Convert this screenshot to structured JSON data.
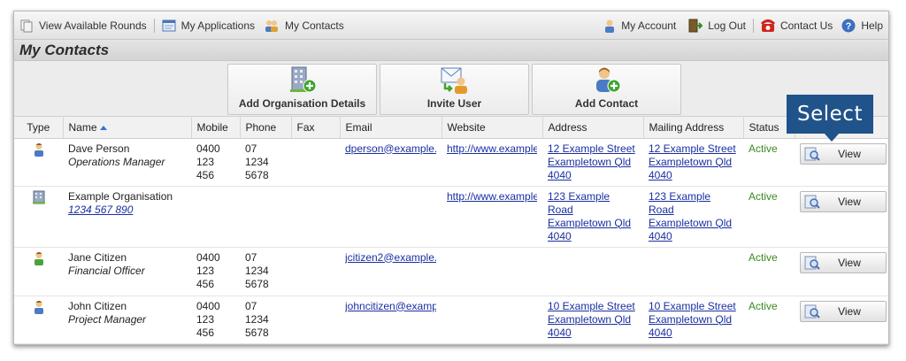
{
  "nav": {
    "left": [
      {
        "label": "View Available Rounds",
        "icon": "rounds-icon"
      },
      {
        "label": "My Applications",
        "icon": "applications-icon"
      },
      {
        "label": "My Contacts",
        "icon": "contacts-icon"
      }
    ],
    "right": [
      {
        "label": "My Account",
        "icon": "account-icon"
      },
      {
        "label": "Log Out",
        "icon": "logout-icon"
      },
      {
        "label": "Contact Us",
        "icon": "phone-icon"
      },
      {
        "label": "Help",
        "icon": "help-icon"
      }
    ]
  },
  "page_title": "My Contacts",
  "actions": [
    {
      "label": "Add Organisation Details",
      "icon": "add-organisation-icon"
    },
    {
      "label": "Invite User",
      "icon": "invite-user-icon"
    },
    {
      "label": "Add Contact",
      "icon": "add-contact-icon"
    }
  ],
  "table": {
    "columns": [
      "Type",
      "Name",
      "Mobile",
      "Phone",
      "Fax",
      "Email",
      "Website",
      "Address",
      "Mailing Address",
      "Status",
      ""
    ],
    "sort_column": "Name",
    "rows": [
      {
        "type": "person",
        "name": "Dave Person",
        "subtitle": "Operations Manager",
        "mobile": [
          "0400",
          "123",
          "456"
        ],
        "phone": [
          "07",
          "1234",
          "5678"
        ],
        "fax": "",
        "email": "dperson@example.",
        "website": "http://www.example",
        "address": [
          "12 Example Street",
          "Exampletown Qld",
          "4040"
        ],
        "mailing": [
          "12 Example Street",
          "Exampletown Qld",
          "4040"
        ],
        "status": "Active",
        "action": "View"
      },
      {
        "type": "organisation",
        "name": "Example Organisation",
        "subtitle": "1234 567 890",
        "mobile": [],
        "phone": [],
        "fax": "",
        "email": "",
        "website": "http://www.example",
        "address": [
          "123 Example",
          "Road",
          "Exampletown Qld",
          "4040"
        ],
        "mailing": [
          "123 Example",
          "Road",
          "Exampletown Qld",
          "4040"
        ],
        "status": "Active",
        "action": "View"
      },
      {
        "type": "person-green",
        "name": "Jane Citizen",
        "subtitle": "Financial Officer",
        "mobile": [
          "0400",
          "123",
          "456"
        ],
        "phone": [
          "07",
          "1234",
          "5678"
        ],
        "fax": "",
        "email": "jcitizen2@example.",
        "website": "",
        "address": [],
        "mailing": [],
        "status": "Active",
        "action": "View"
      },
      {
        "type": "person",
        "name": "John Citizen",
        "subtitle": "Project Manager",
        "mobile": [
          "0400",
          "123",
          "456"
        ],
        "phone": [
          "07",
          "1234",
          "5678"
        ],
        "fax": "",
        "email": "johncitizen@examp",
        "website": "",
        "address": [
          "10 Example Street",
          "Exampletown Qld",
          "4040"
        ],
        "mailing": [
          "10 Example Street",
          "Exampletown Qld",
          "4040"
        ],
        "status": "Active",
        "action": "View"
      }
    ]
  },
  "callout": "Select",
  "colors": {
    "status_active": "#3a8a20",
    "link": "#1a2fa0",
    "callout": "#1f5389"
  }
}
